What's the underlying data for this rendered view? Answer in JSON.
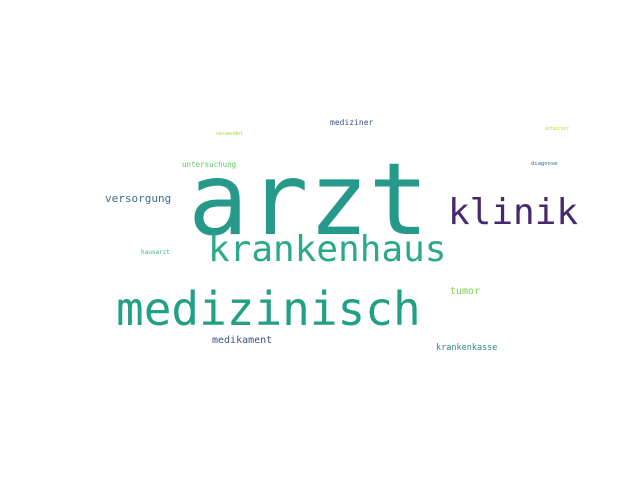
{
  "wordcloud": {
    "words": [
      {
        "id": "w-arzt",
        "text": "arzt",
        "color": "#26998a"
      },
      {
        "id": "w-krankenhaus",
        "text": "krankenhaus",
        "color": "#2aaa88"
      },
      {
        "id": "w-klinik",
        "text": "klinik",
        "color": "#46286f"
      },
      {
        "id": "w-medizinisch",
        "text": "medizinisch",
        "color": "#22a085"
      },
      {
        "id": "w-versorgung",
        "text": "versorgung",
        "color": "#3c6e8d"
      },
      {
        "id": "w-untersuchung",
        "text": "untersuchung",
        "color": "#5ec962"
      },
      {
        "id": "w-verwendet",
        "text": "verwendet",
        "color": "#a0da39"
      },
      {
        "id": "w-mediziner",
        "text": "mediziner",
        "color": "#3b528b"
      },
      {
        "id": "w-arbeiter",
        "text": "arbeiter",
        "color": "#b5de2b"
      },
      {
        "id": "w-diagnose",
        "text": "diagnose",
        "color": "#31688e"
      },
      {
        "id": "w-hausarzt",
        "text": "hausarzt",
        "color": "#35b779"
      },
      {
        "id": "w-tumor",
        "text": "tumor",
        "color": "#7ad151"
      },
      {
        "id": "w-medikament",
        "text": "medikament",
        "color": "#3b528b"
      },
      {
        "id": "w-krankenkasse",
        "text": "krankenkasse",
        "color": "#2c8a8c"
      }
    ]
  }
}
